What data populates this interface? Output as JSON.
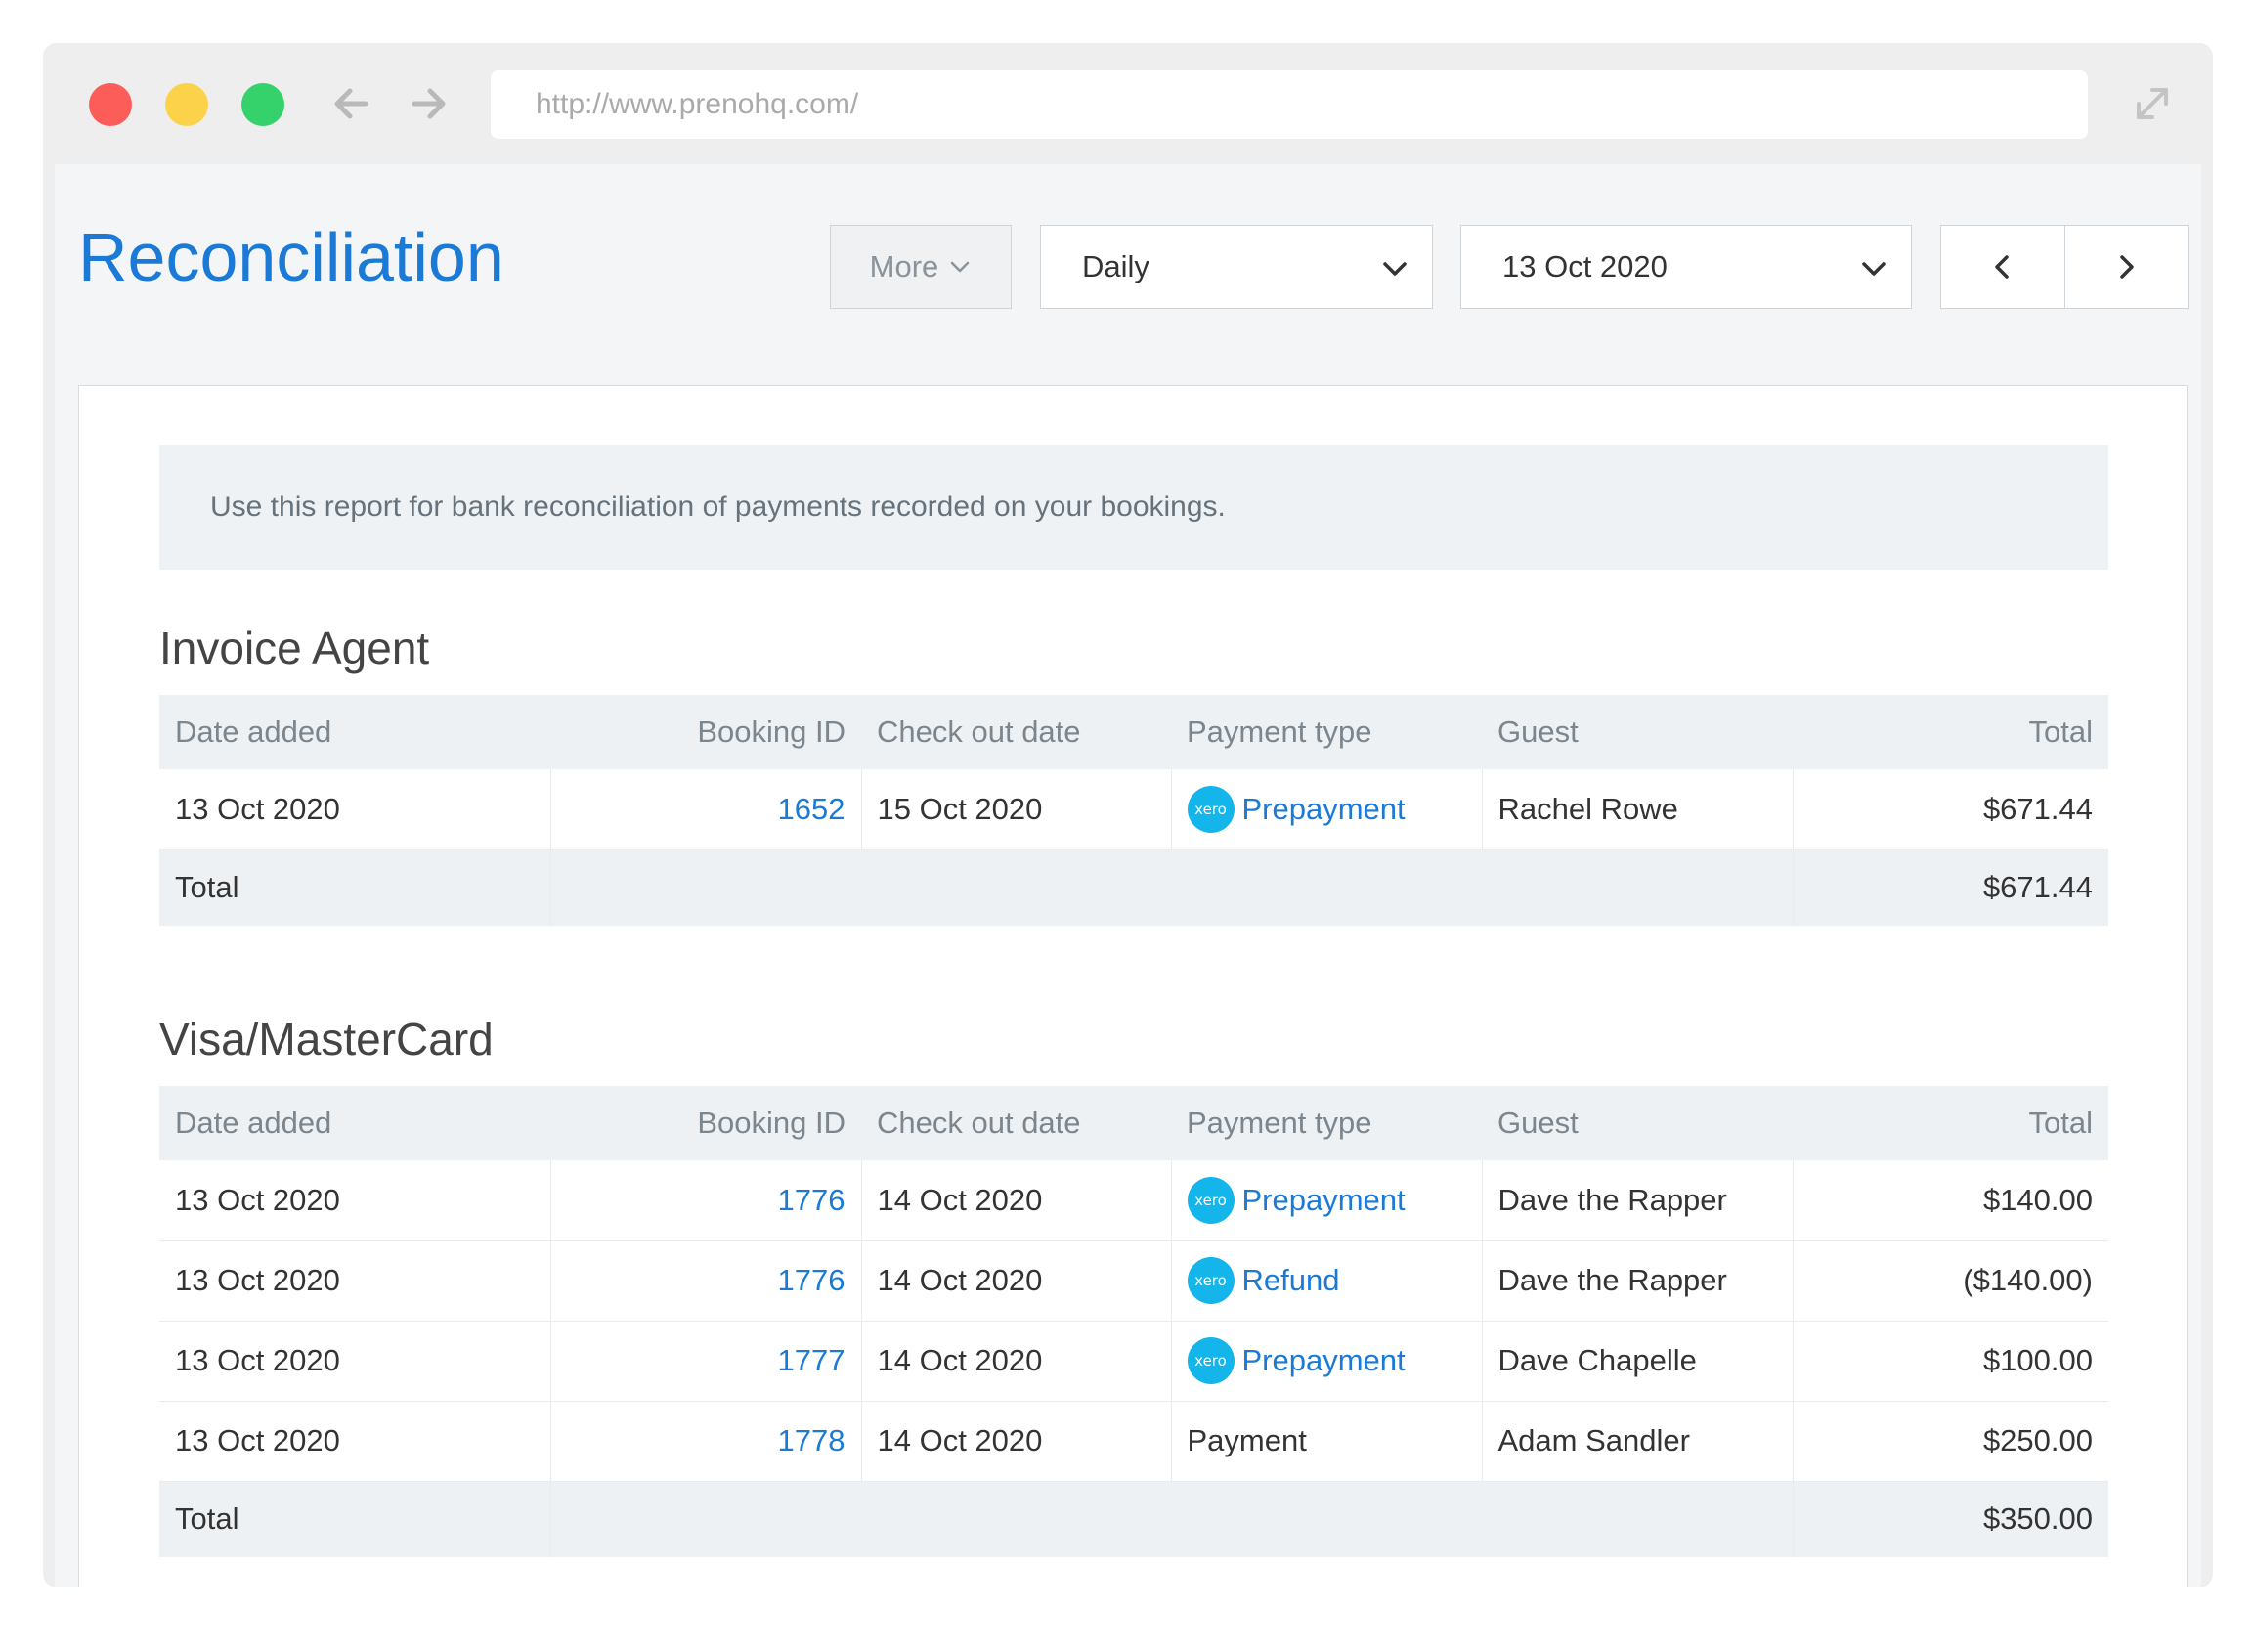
{
  "browser": {
    "url": "http://www.prenohq.com/"
  },
  "header": {
    "title": "Reconciliation",
    "more_label": "More",
    "period_select": "Daily",
    "date_select": "13 Oct 2020"
  },
  "notice": "Use this report for bank reconciliation of payments recorded on your bookings.",
  "columns": [
    "Date added",
    "Booking ID",
    "Check out date",
    "Payment type",
    "Guest",
    "Total"
  ],
  "icons": {
    "xero_badge": "xero"
  },
  "sections": [
    {
      "title": "Invoice Agent",
      "rows": [
        {
          "date": "13 Oct 2020",
          "booking_id": "1652",
          "checkout": "15 Oct 2020",
          "payment_type": "Prepayment",
          "xero": true,
          "guest": "Rachel Rowe",
          "total": "$671.44"
        }
      ],
      "total_label": "Total",
      "total": "$671.44"
    },
    {
      "title": "Visa/MasterCard",
      "rows": [
        {
          "date": "13 Oct 2020",
          "booking_id": "1776",
          "checkout": "14 Oct 2020",
          "payment_type": "Prepayment",
          "xero": true,
          "guest": "Dave the Rapper",
          "total": "$140.00"
        },
        {
          "date": "13 Oct 2020",
          "booking_id": "1776",
          "checkout": "14 Oct 2020",
          "payment_type": "Refund",
          "xero": true,
          "guest": "Dave the Rapper",
          "total": "($140.00)"
        },
        {
          "date": "13 Oct 2020",
          "booking_id": "1777",
          "checkout": "14 Oct 2020",
          "payment_type": "Prepayment",
          "xero": true,
          "guest": "Dave Chapelle",
          "total": "$100.00"
        },
        {
          "date": "13 Oct 2020",
          "booking_id": "1778",
          "checkout": "14 Oct 2020",
          "payment_type": "Payment",
          "xero": false,
          "guest": "Adam Sandler",
          "total": "$250.00"
        }
      ],
      "total_label": "Total",
      "total": "$350.00"
    }
  ]
}
